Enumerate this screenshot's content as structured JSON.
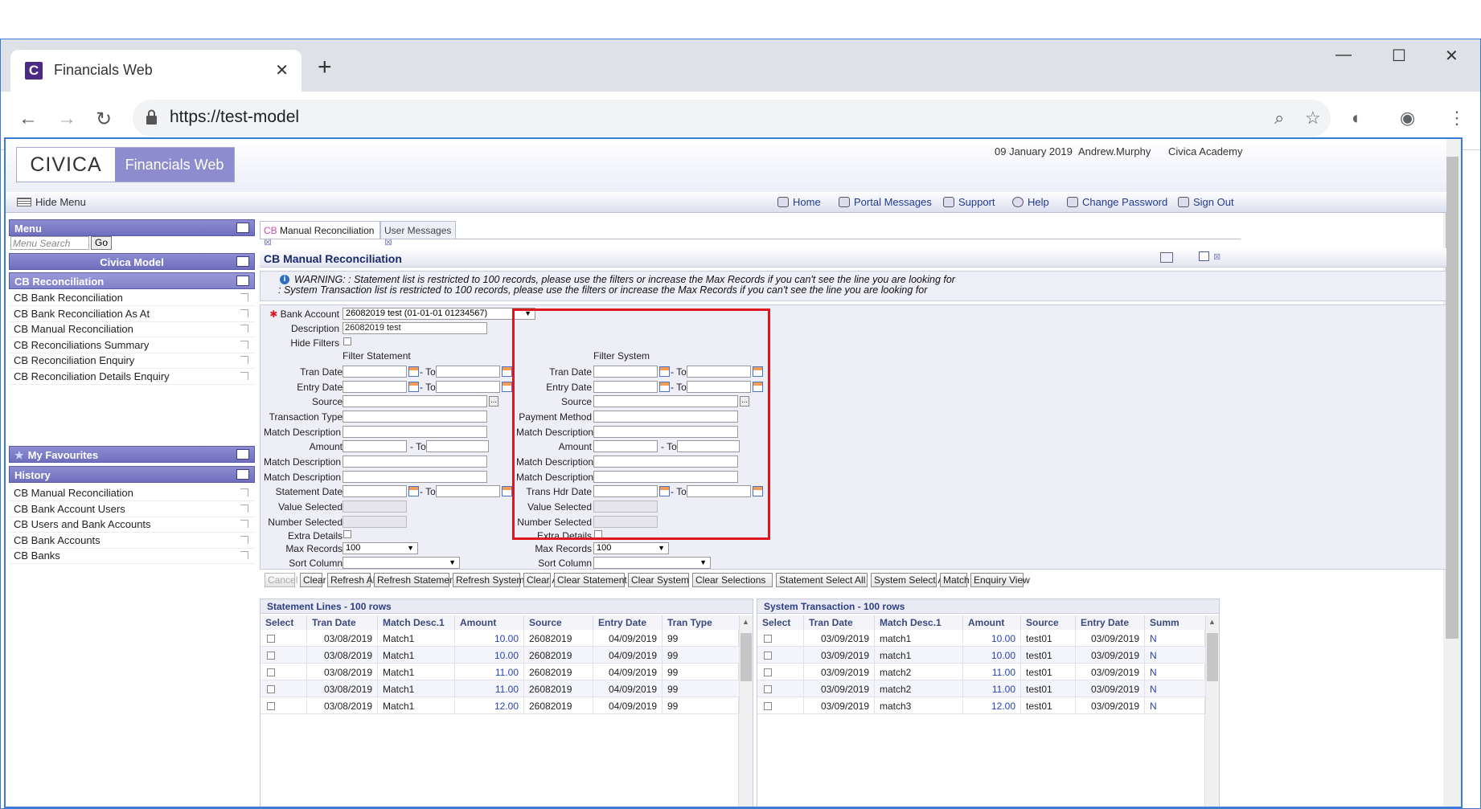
{
  "browser": {
    "tab_title": "Financials Web",
    "favicon_letter": "C",
    "new_tab": "+",
    "url": "https://test-model",
    "controls": {
      "minimize": "—",
      "maximize": "☐",
      "close": "✕"
    }
  },
  "header": {
    "logo_civica": "CIVICA",
    "logo_product": "Financials Web",
    "date": "09 January 2019",
    "user": "Andrew.Murphy",
    "org": "Civica Academy"
  },
  "toolbar": {
    "hide_menu": "Hide Menu",
    "links": [
      "Home",
      "Portal Messages",
      "Support",
      "Help",
      "Change Password",
      "Sign Out"
    ]
  },
  "menu": {
    "title": "Menu",
    "search_placeholder": "Menu Search",
    "go": "Go",
    "model": "Civica Model",
    "section": "CB Reconciliation",
    "items": [
      "CB Bank Reconciliation",
      "CB Bank Reconciliation As At",
      "CB Manual Reconciliation",
      "CB Reconciliations Summary",
      "CB Reconciliation Enquiry",
      "CB Reconciliation Details Enquiry"
    ],
    "favourites": "My Favourites",
    "history_title": "History",
    "history": [
      "CB Manual Reconciliation",
      "CB Bank Account Users",
      "CB Users and Bank Accounts",
      "CB Bank Accounts",
      "CB Banks"
    ]
  },
  "tabs": {
    "active_prefix": "CB",
    "active": "Manual Reconciliation",
    "other": "User Messages"
  },
  "page": {
    "title": "CB Manual Reconciliation",
    "warning1": "WARNING: : Statement list is restricted to 100 records, please use the filters or increase the Max Records if you can't see the line you are looking for",
    "warning2": ": System Transaction list is restricted to 100 records, please use the filters or increase the Max Records if you can't see the line you are looking for"
  },
  "form": {
    "bank_account_label": "Bank Account",
    "bank_account_value": "26082019 test (01-01-01 01234567)",
    "description_label": "Description",
    "description_value": "26082019 test",
    "hide_filters_label": "Hide Filters",
    "filter_statement": "Filter Statement",
    "filter_system": "Filter System",
    "to": "- To",
    "stmt_labels": [
      "Tran Date",
      "Entry Date",
      "Source",
      "Transaction Type",
      "Match Description 1",
      "Amount",
      "Match Description 2",
      "Match Description 3",
      "Statement Date",
      "Value Selected",
      "Number Selected",
      "Extra Details",
      "Max Records",
      "Sort Column"
    ],
    "sys_labels": [
      "Tran Date",
      "Entry Date",
      "Source",
      "Payment Method",
      "Match Description 1",
      "Amount",
      "Match Description 2",
      "Match Description 3",
      "Trans Hdr Date",
      "Value Selected",
      "Number Selected",
      "Extra Details",
      "Max Records",
      "Sort Column"
    ],
    "max_records": "100"
  },
  "buttons": [
    "Cancel",
    "Clear",
    "Refresh All",
    "Refresh Statement",
    "Refresh System",
    "Clear All",
    "Clear Statement",
    "Clear System",
    "Clear Selections",
    "Statement Select All",
    "System Select All",
    "Match",
    "Enquiry View"
  ],
  "statement_grid": {
    "title": "Statement Lines - 100 rows",
    "headers": [
      "Select",
      "Tran Date",
      "Match Desc.1",
      "Amount",
      "Source",
      "Entry Date",
      "Tran Type"
    ],
    "rows": [
      [
        "03/08/2019",
        "Match1",
        "10.00",
        "26082019",
        "04/09/2019",
        "99"
      ],
      [
        "03/08/2019",
        "Match1",
        "10.00",
        "26082019",
        "04/09/2019",
        "99"
      ],
      [
        "03/08/2019",
        "Match1",
        "11.00",
        "26082019",
        "04/09/2019",
        "99"
      ],
      [
        "03/08/2019",
        "Match1",
        "11.00",
        "26082019",
        "04/09/2019",
        "99"
      ],
      [
        "03/08/2019",
        "Match1",
        "12.00",
        "26082019",
        "04/09/2019",
        "99"
      ]
    ]
  },
  "system_grid": {
    "title": "System Transaction - 100 rows",
    "headers": [
      "Select",
      "Tran Date",
      "Match Desc.1",
      "Amount",
      "Source",
      "Entry Date",
      "Summ"
    ],
    "rows": [
      [
        "03/09/2019",
        "match1",
        "10.00",
        "test01",
        "03/09/2019",
        "N"
      ],
      [
        "03/09/2019",
        "match1",
        "10.00",
        "test01",
        "03/09/2019",
        "N"
      ],
      [
        "03/09/2019",
        "match2",
        "11.00",
        "test01",
        "03/09/2019",
        "N"
      ],
      [
        "03/09/2019",
        "match2",
        "11.00",
        "test01",
        "03/09/2019",
        "N"
      ],
      [
        "03/09/2019",
        "match3",
        "12.00",
        "test01",
        "03/09/2019",
        "N"
      ]
    ]
  },
  "colors": {
    "accent": "#8c8ccf",
    "highlight": "#e0161f",
    "link": "#2743b5"
  }
}
